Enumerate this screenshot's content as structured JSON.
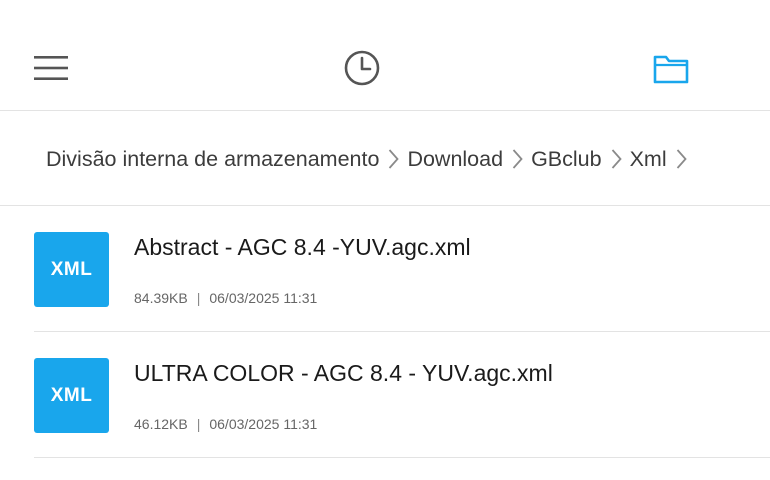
{
  "toolbar": {
    "menu_icon": "hamburger-menu-icon",
    "history_icon": "clock-history-icon",
    "folder_icon": "folder-icon",
    "accent_color": "#19a6ec"
  },
  "breadcrumb": {
    "items": [
      "Divisão interna de armazenamento",
      "Download",
      "GBclub",
      "Xml"
    ]
  },
  "files": [
    {
      "icon_label": "XML",
      "name": "Abstract - AGC 8.4 -YUV.agc.xml",
      "size": "84.39KB",
      "separator": "|",
      "date": "06/03/2025 11:31"
    },
    {
      "icon_label": "XML",
      "name": "ULTRA COLOR - AGC 8.4 - YUV.agc.xml",
      "size": "46.12KB",
      "separator": "|",
      "date": "06/03/2025 11:31"
    }
  ]
}
